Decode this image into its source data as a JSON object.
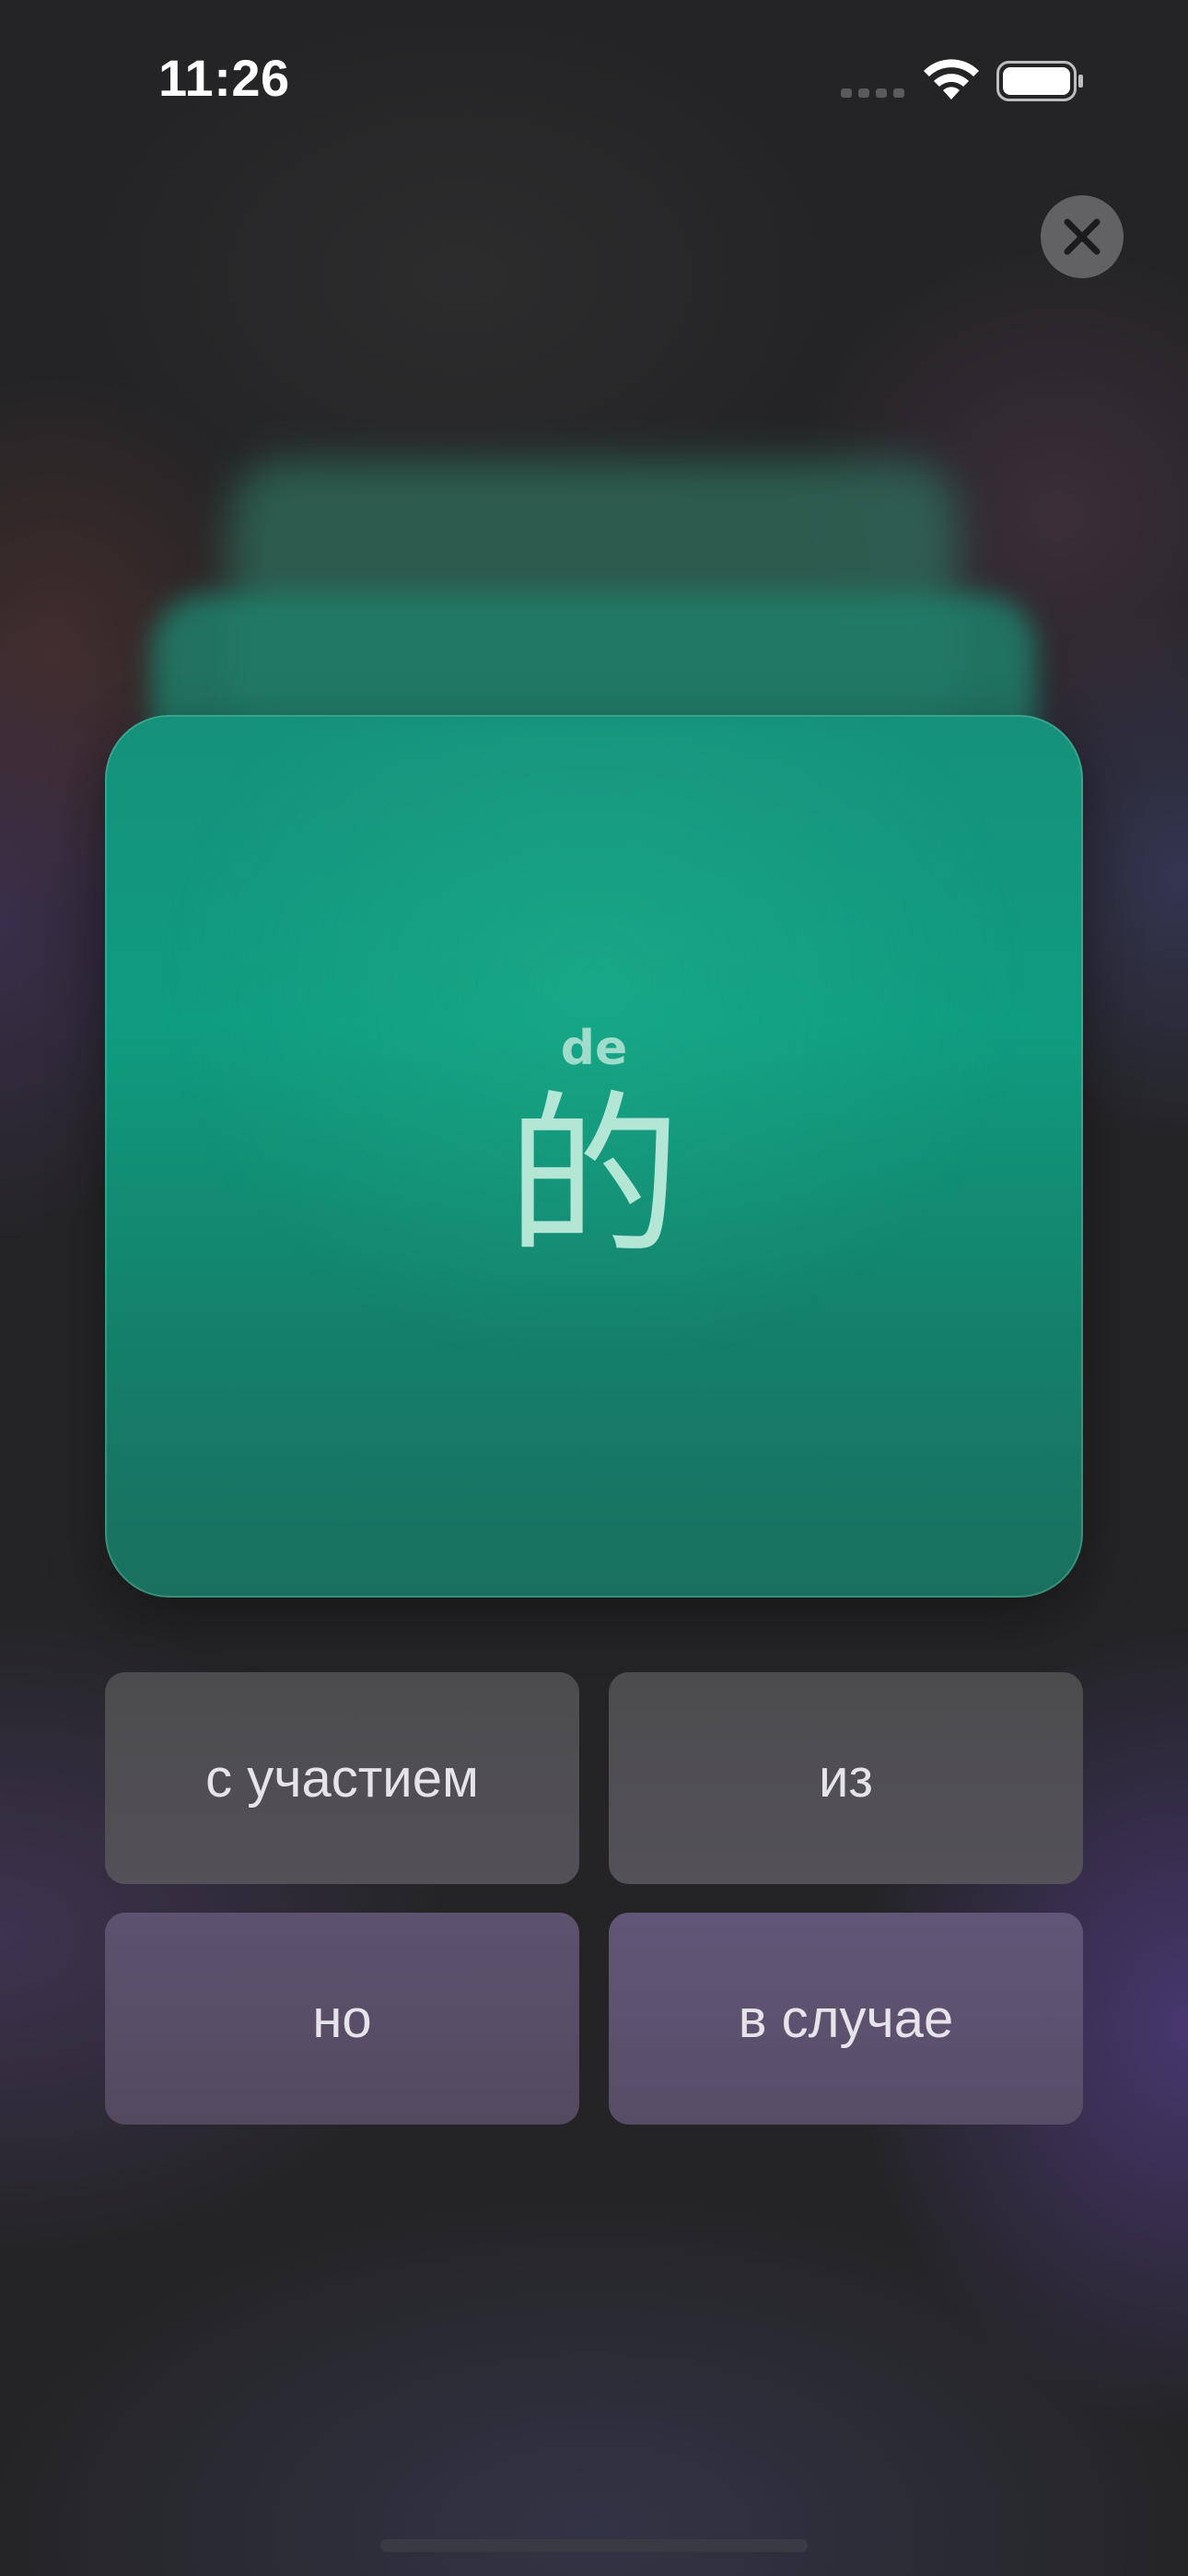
{
  "status_bar": {
    "time": "11:26",
    "signal_icon": "cellular-signal-icon",
    "wifi_icon": "wifi-icon",
    "battery_icon": "battery-full-icon"
  },
  "close_button": {
    "icon": "close-icon"
  },
  "card": {
    "pinyin": "de",
    "character": "的"
  },
  "answers": [
    {
      "label": "с участием"
    },
    {
      "label": "из"
    },
    {
      "label": "но"
    },
    {
      "label": "в случае"
    }
  ],
  "colors": {
    "card_accent": "#0f9c80",
    "background": "#242426",
    "answer_text": "#e6e4ea"
  }
}
